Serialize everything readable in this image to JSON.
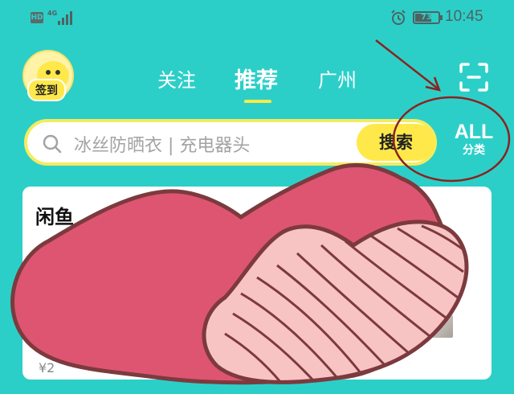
{
  "status_bar": {
    "hd": "HD",
    "network": "4G",
    "battery": "73",
    "battery_level": 0.73,
    "time": "10:45",
    "icons": [
      "signal-icon",
      "alarm-icon",
      "battery-icon"
    ]
  },
  "header": {
    "checkin_label": "签到",
    "tabs": [
      {
        "label": "关注",
        "active": false
      },
      {
        "label": "推荐",
        "active": true
      },
      {
        "label": "广州",
        "active": false
      }
    ],
    "scan_icon": "scan-icon"
  },
  "search": {
    "placeholder": "冰丝防晒衣 | 充电器头",
    "button_label": "搜索",
    "search_icon": "search-icon"
  },
  "category": {
    "all_label": "ALL",
    "label": "分类"
  },
  "card": {
    "title": "闲鱼",
    "price": "¥2"
  },
  "colors": {
    "background": "#2ccfc8",
    "accent_yellow": "#ffe94a",
    "heart_red": "#de5571",
    "heart_pink": "#f8c3c3",
    "annotation": "#8a2320"
  }
}
